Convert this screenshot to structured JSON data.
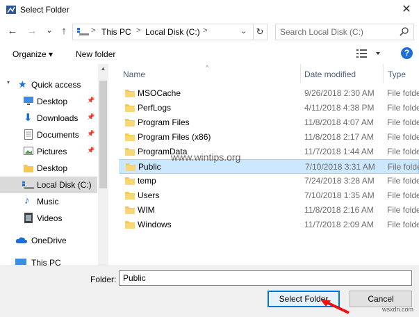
{
  "window": {
    "title": "Select Folder"
  },
  "nav": {
    "back": "←",
    "forward": "→",
    "recent": "⌄",
    "up": "↑",
    "breadcrumb": [
      "This PC",
      "Local Disk (C:)"
    ],
    "separator": ">",
    "refresh": "↻",
    "search_placeholder": "Search Local Disk (C:)"
  },
  "toolbar": {
    "organize": "Organize ▾",
    "new_folder": "New folder",
    "help": "?"
  },
  "sidebar": {
    "items": [
      {
        "label": "Quick access",
        "icon": "star-icon",
        "pinned": false
      },
      {
        "label": "Desktop",
        "icon": "desktop-icon",
        "pinned": true
      },
      {
        "label": "Downloads",
        "icon": "download-icon",
        "pinned": true
      },
      {
        "label": "Documents",
        "icon": "documents-icon",
        "pinned": true
      },
      {
        "label": "Pictures",
        "icon": "pictures-icon",
        "pinned": true
      },
      {
        "label": "Desktop",
        "icon": "folder-icon",
        "pinned": false
      },
      {
        "label": "Local Disk (C:)",
        "icon": "drive-icon",
        "pinned": false,
        "selected": true
      },
      {
        "label": "Music",
        "icon": "music-icon",
        "pinned": false
      },
      {
        "label": "Videos",
        "icon": "videos-icon",
        "pinned": false
      },
      {
        "label": "OneDrive",
        "icon": "cloud-icon",
        "pinned": false
      },
      {
        "label": "This PC",
        "icon": "pc-icon",
        "pinned": false
      }
    ],
    "pin_glyph": "📌"
  },
  "columns": {
    "name": "Name",
    "date": "Date modified",
    "type": "Type"
  },
  "files": [
    {
      "name": "MSOCache",
      "date": "9/26/2018 2:30 AM",
      "type": "File folder"
    },
    {
      "name": "PerfLogs",
      "date": "4/11/2018 4:38 PM",
      "type": "File folder"
    },
    {
      "name": "Program Files",
      "date": "11/8/2018 4:07 AM",
      "type": "File folder"
    },
    {
      "name": "Program Files (x86)",
      "date": "11/8/2018 2:17 AM",
      "type": "File folder"
    },
    {
      "name": "ProgramData",
      "date": "11/7/2018 1:44 AM",
      "type": "File folder"
    },
    {
      "name": "Public",
      "date": "7/10/2018 3:31 AM",
      "type": "File folder",
      "selected": true
    },
    {
      "name": "temp",
      "date": "7/24/2018 3:28 AM",
      "type": "File folder"
    },
    {
      "name": "Users",
      "date": "7/10/2018 1:35 AM",
      "type": "File folder"
    },
    {
      "name": "WIM",
      "date": "11/8/2018 2:16 AM",
      "type": "File folder"
    },
    {
      "name": "Windows",
      "date": "11/7/2018 2:09 AM",
      "type": "File folder"
    }
  ],
  "footer": {
    "folder_label": "Folder:",
    "folder_value": "Public",
    "select_button": "Select Folder",
    "cancel_button": "Cancel"
  },
  "watermarks": {
    "main": "www.wintips.org",
    "corner": "wsxdn.com"
  },
  "colors": {
    "accent": "#0078d7",
    "selection": "#cce8ff",
    "folder": "#f5c851"
  }
}
